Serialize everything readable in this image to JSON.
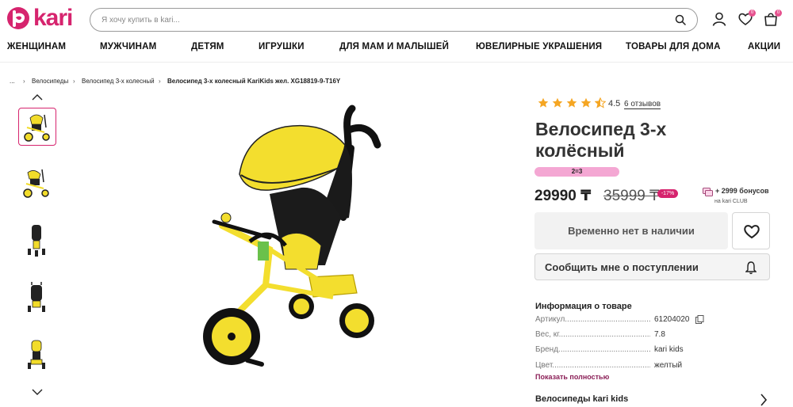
{
  "header": {
    "logo_text": "kari",
    "search_placeholder": "Я хочу купить в kari...",
    "favorites_count": "0",
    "cart_count": "0"
  },
  "nav": {
    "items": [
      "ЖЕНЩИНАМ",
      "МУЖЧИНАМ",
      "ДЕТЯМ",
      "ИГРУШКИ",
      "ДЛЯ МАМ И МАЛЫШЕЙ",
      "ЮВЕЛИРНЫЕ УКРАШЕНИЯ",
      "ТОВАРЫ ДЛЯ ДОМА",
      "АКЦИИ"
    ]
  },
  "breadcrumb": {
    "ellipsis": "...",
    "items": [
      "Велосипеды",
      "Велосипед 3-х колесный",
      "Велосипед 3-х колесный KariKids жел. XG18819-9-T16Y"
    ]
  },
  "product": {
    "rating": "4.5",
    "reviews": "6 отзывов",
    "title": "Велосипед 3-х колёсный",
    "promo": "2=3",
    "price": "29990 ₸",
    "old_price": "35999 ₸",
    "discount": "-17%",
    "bonus": "+ 2999 бонусов",
    "bonus_sub": "на kari CLUB",
    "availability": "Временно нет в наличии",
    "notify": "Сообщить мне о поступлении"
  },
  "info": {
    "title": "Информация о товаре",
    "rows": [
      {
        "label": "Артикул..................................................",
        "value": "61204020"
      },
      {
        "label": "Вес, кг...................................................",
        "value": "7.8"
      },
      {
        "label": "Бренд.....................................................",
        "value": "kari kids"
      },
      {
        "label": "Цвет.......................................................",
        "value": "желтый"
      }
    ],
    "show_all": "Показать полностью"
  },
  "series": "Велосипеды kari kids",
  "colors": {
    "brand": "#d6246e",
    "promo": "#f4a7d3",
    "star": "#f5a623"
  }
}
